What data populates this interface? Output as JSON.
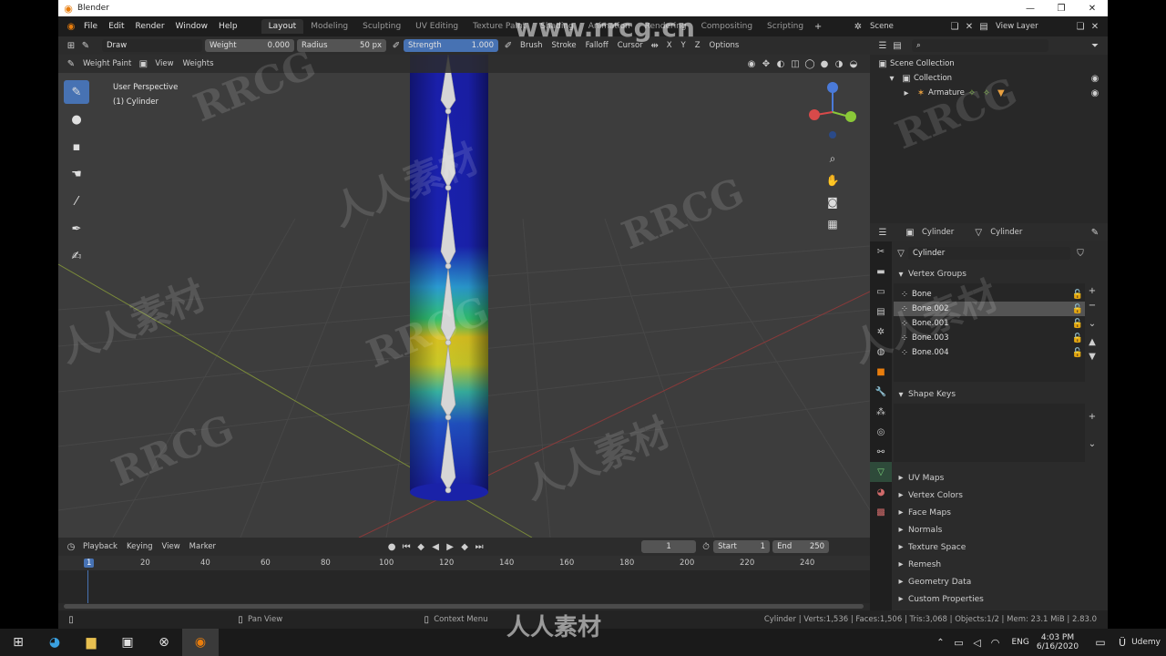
{
  "window": {
    "title": "Blender"
  },
  "menu": {
    "items": [
      "File",
      "Edit",
      "Render",
      "Window",
      "Help"
    ]
  },
  "workspaces": {
    "tabs": [
      "Layout",
      "Modeling",
      "Sculpting",
      "UV Editing",
      "Texture Paint",
      "Shading",
      "Animation",
      "Rendering",
      "Compositing",
      "Scripting"
    ],
    "active": "Layout"
  },
  "scene": {
    "label": "Scene",
    "view_layer": "View Layer"
  },
  "tool_header": {
    "brush": "Draw",
    "weight_label": "Weight",
    "weight_value": "0.000",
    "radius_label": "Radius",
    "radius_value": "50 px",
    "strength_label": "Strength",
    "strength_value": "1.000",
    "brush_menu": "Brush",
    "stroke_menu": "Stroke",
    "falloff_menu": "Falloff",
    "cursor_menu": "Cursor",
    "x": "X",
    "y": "Y",
    "z": "Z",
    "options": "Options"
  },
  "viewport_header": {
    "mode": "Weight Paint",
    "view": "View",
    "weights": "Weights"
  },
  "viewport": {
    "perspective": "User Perspective",
    "object": "(1) Cylinder"
  },
  "timeline": {
    "playback": "Playback",
    "keying": "Keying",
    "view": "View",
    "marker": "Marker",
    "current_frame": "1",
    "start_label": "Start",
    "start": "1",
    "end_label": "End",
    "end": "250",
    "ticks": [
      "1",
      "20",
      "40",
      "60",
      "80",
      "100",
      "120",
      "140",
      "160",
      "180",
      "200",
      "220",
      "240"
    ]
  },
  "status": {
    "pan": "Pan View",
    "context": "Context Menu",
    "info": "Cylinder | Verts:1,536 | Faces:1,506 | Tris:3,068 | Objects:1/2 | Mem: 23.1 MiB | 2.83.0"
  },
  "outliner": {
    "root": "Scene Collection",
    "collection": "Collection",
    "armature": "Armature"
  },
  "properties": {
    "tab_object": "Cylinder",
    "tab_data": "Cylinder",
    "mesh_name": "Cylinder",
    "vertex_groups_title": "Vertex Groups",
    "vertex_groups": [
      "Bone",
      "Bone.002",
      "Bone.001",
      "Bone.003",
      "Bone.004"
    ],
    "selected_group": "Bone.002",
    "shape_keys_title": "Shape Keys",
    "sections": [
      "UV Maps",
      "Vertex Colors",
      "Face Maps",
      "Normals",
      "Texture Space",
      "Remesh",
      "Geometry Data",
      "Custom Properties"
    ]
  },
  "taskbar": {
    "lang": "ENG",
    "time": "4:03 PM",
    "date": "6/16/2020",
    "udemy": "Udemy"
  },
  "watermarks": {
    "site": "www.rrcg.cn",
    "brand": "RRCG",
    "cn": "人人素材"
  },
  "colors": {
    "accent": "#4772b3",
    "viewport_bg": "#3d3d3d",
    "panel_bg": "#2b2b2b"
  }
}
